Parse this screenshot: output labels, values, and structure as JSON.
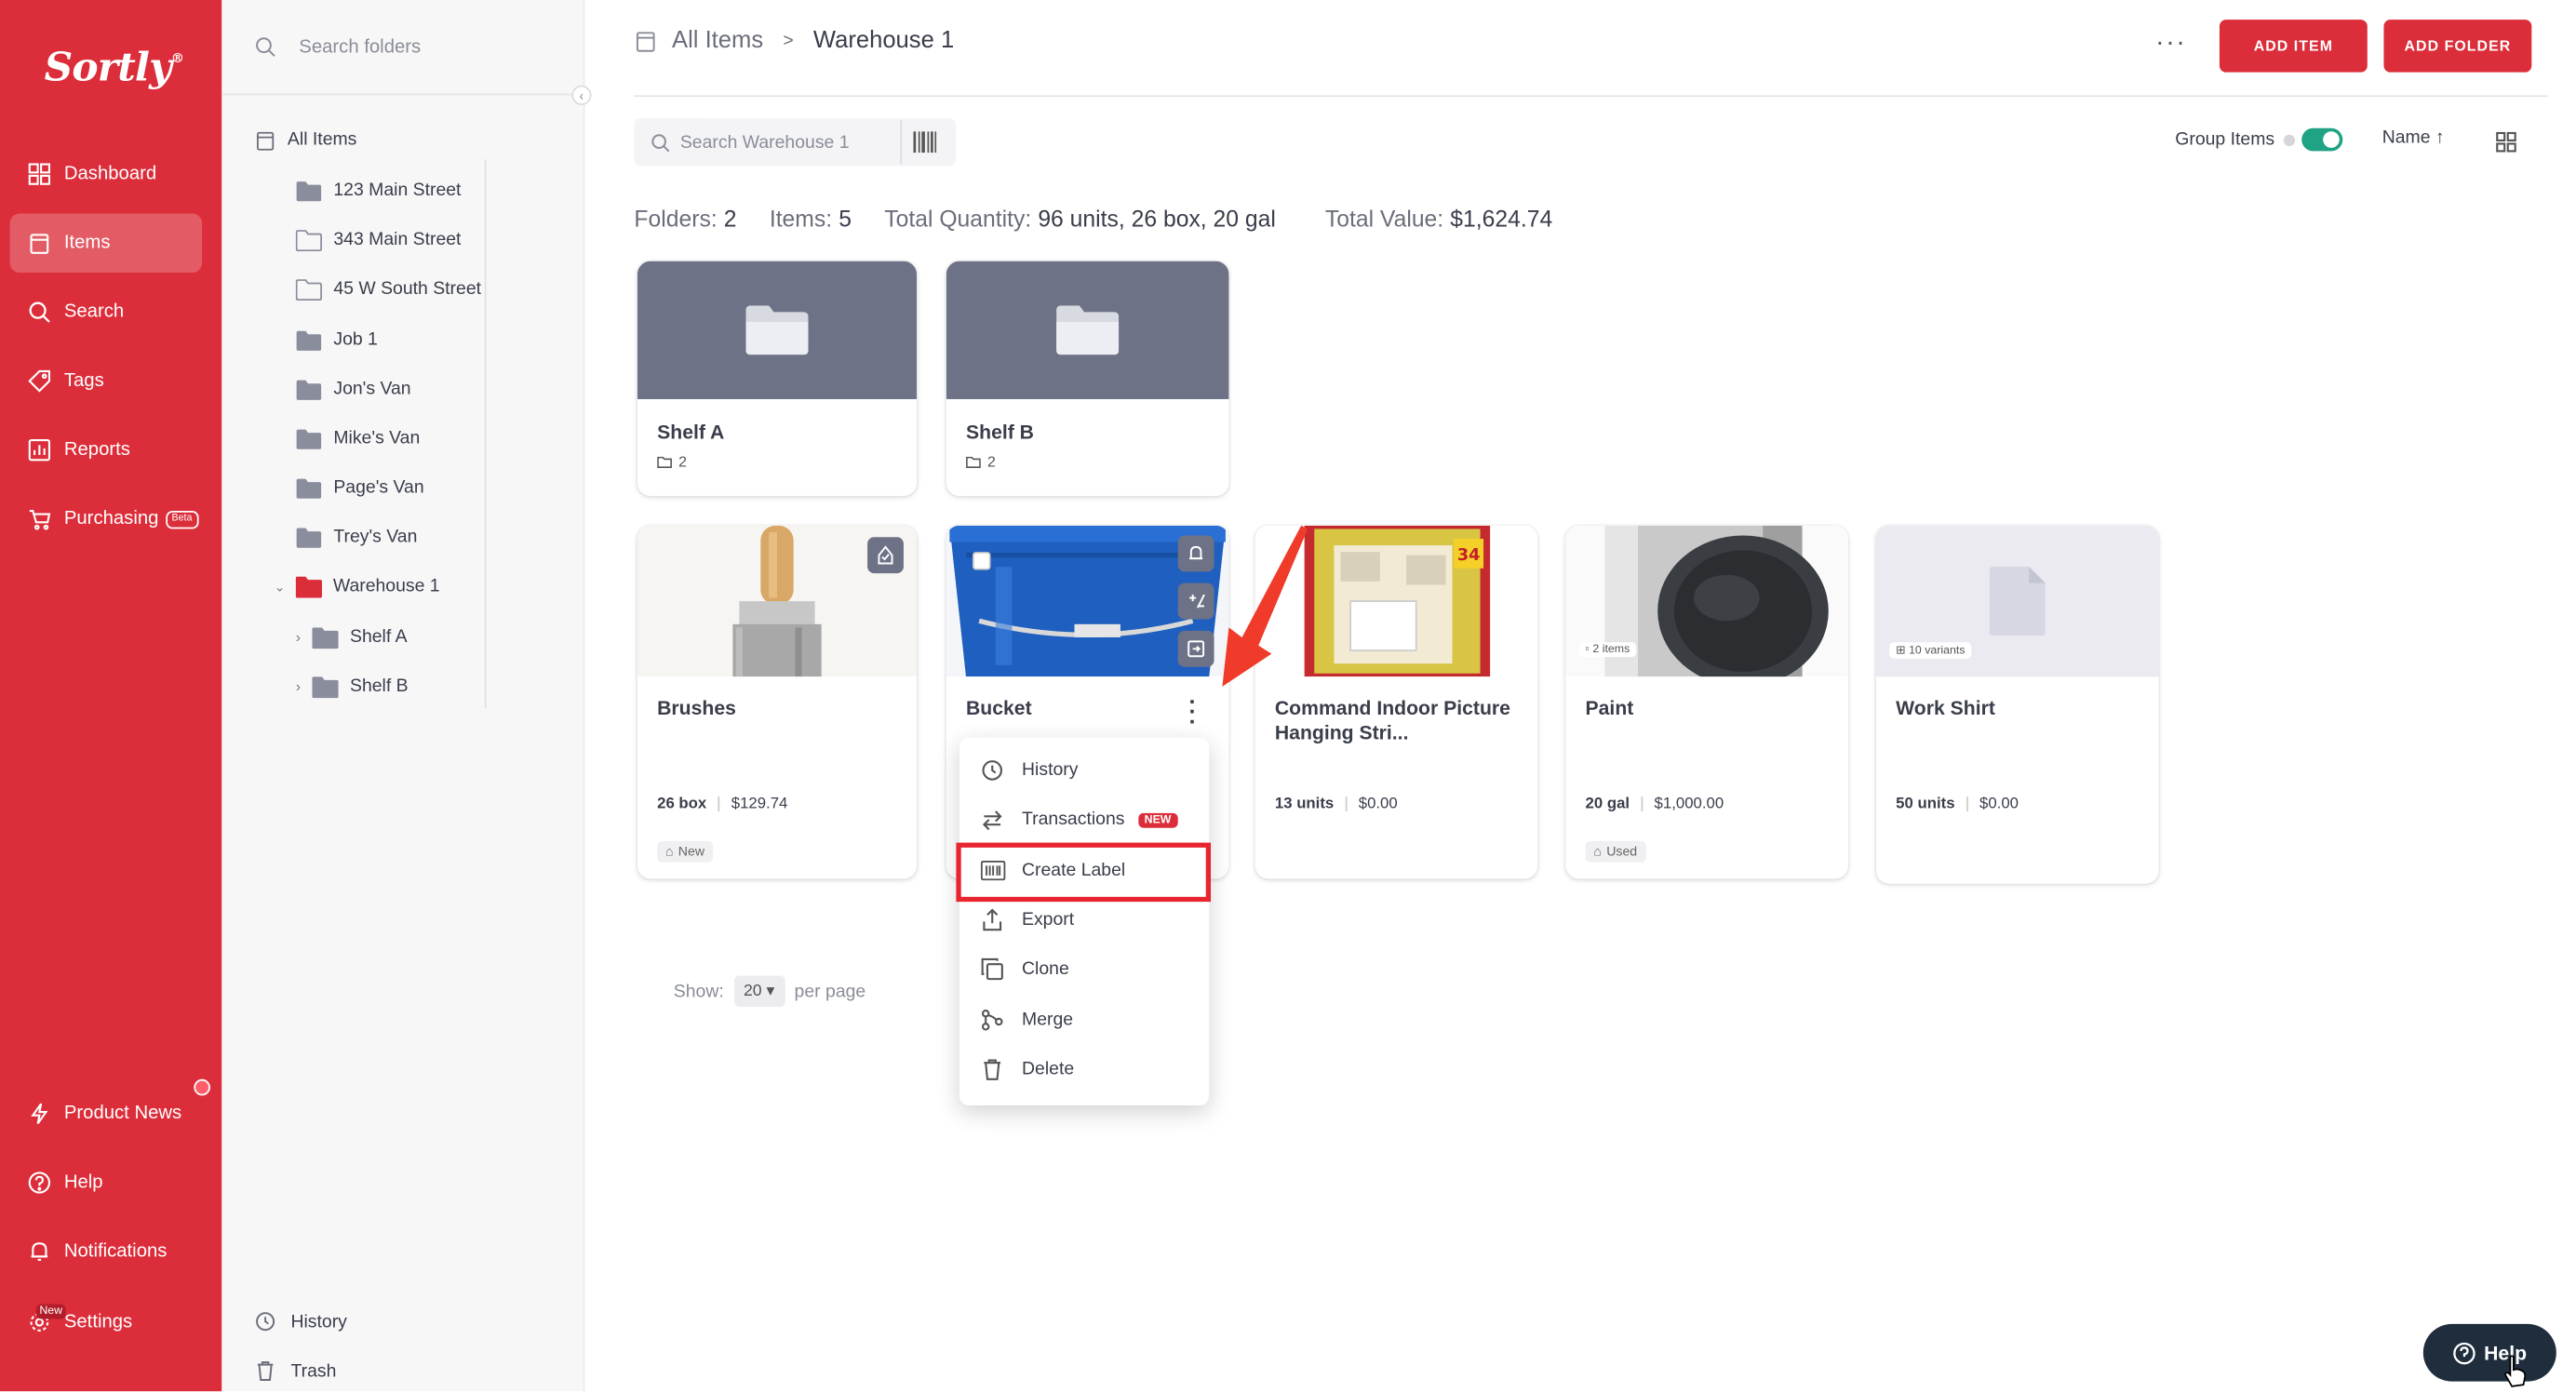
{
  "app": {
    "logo": "Sortly",
    "logo_mark": "®"
  },
  "nav": {
    "top": [
      {
        "label": "Dashboard",
        "icon": "dashboard-icon"
      },
      {
        "label": "Items",
        "icon": "items-icon",
        "active": true
      },
      {
        "label": "Search",
        "icon": "search-icon"
      },
      {
        "label": "Tags",
        "icon": "tag-icon"
      },
      {
        "label": "Reports",
        "icon": "reports-icon"
      },
      {
        "label": "Purchasing",
        "icon": "cart-icon",
        "badge": "Beta"
      }
    ],
    "bottom": [
      {
        "label": "Product News",
        "icon": "bolt-icon"
      },
      {
        "label": "Help",
        "icon": "help-icon"
      },
      {
        "label": "Notifications",
        "icon": "bell-icon"
      },
      {
        "label": "Settings",
        "icon": "gear-icon",
        "badge": "New"
      }
    ]
  },
  "folders": {
    "search_placeholder": "Search folders",
    "root": "All Items",
    "items": [
      "123 Main Street",
      "343 Main Street",
      "45 W South Street",
      "Job 1",
      "Jon's Van",
      "Mike's Van",
      "Page's Van",
      "Trey's Van"
    ],
    "expanded": "Warehouse 1",
    "children": [
      "Shelf A",
      "Shelf B"
    ],
    "footer": {
      "history": "History",
      "trash": "Trash"
    }
  },
  "breadcrumb": {
    "root": "All Items",
    "separator": ">",
    "current": "Warehouse 1"
  },
  "header": {
    "add_item": "ADD ITEM",
    "add_folder": "ADD FOLDER",
    "more": "···"
  },
  "toolbar": {
    "search_placeholder": "Search Warehouse 1",
    "group_items": "Group Items",
    "group_on": true,
    "sort": "Name"
  },
  "stats": {
    "folders_label": "Folders:",
    "folders": "2",
    "items_label": "Items:",
    "items": "5",
    "qty_label": "Total Quantity:",
    "qty": "96 units, 26 box, 20 gal",
    "value_label": "Total Value:",
    "value": "$1,624.74"
  },
  "folder_cards": [
    {
      "name": "Shelf A",
      "count": "2"
    },
    {
      "name": "Shelf B",
      "count": "2"
    }
  ],
  "item_cards": [
    {
      "name": "Brushes",
      "qty": "26 box",
      "price": "$129.74",
      "tag": "New"
    },
    {
      "name": "Bucket",
      "qty": "",
      "price": "",
      "tag": ""
    },
    {
      "name": "Command Indoor Picture Hanging Stri...",
      "qty": "13 units",
      "price": "$0.00",
      "tag": "",
      "image_text": "34"
    },
    {
      "name": "Paint",
      "qty": "20 gal",
      "price": "$1,000.00",
      "tag": "Used",
      "badge": "2 items"
    },
    {
      "name": "Work Shirt",
      "qty": "50 units",
      "price": "$0.00",
      "tag": "",
      "badge": "10 variants"
    }
  ],
  "context_menu": {
    "items": [
      {
        "label": "History",
        "icon": "history-icon"
      },
      {
        "label": "Transactions",
        "icon": "transactions-icon",
        "badge": "NEW"
      },
      {
        "label": "Create Label",
        "icon": "barcode-icon",
        "highlighted": true
      },
      {
        "label": "Export",
        "icon": "export-icon"
      },
      {
        "label": "Clone",
        "icon": "clone-icon"
      },
      {
        "label": "Merge",
        "icon": "merge-icon"
      },
      {
        "label": "Delete",
        "icon": "trash-icon"
      }
    ]
  },
  "pager": {
    "show": "Show:",
    "value": "20",
    "per_page": "per page"
  },
  "help_button": "Help",
  "colors": {
    "brand": "#dc2d3a",
    "toggle": "#1fa384",
    "folder_card": "#6e7286",
    "highlight": "#e8252f"
  }
}
